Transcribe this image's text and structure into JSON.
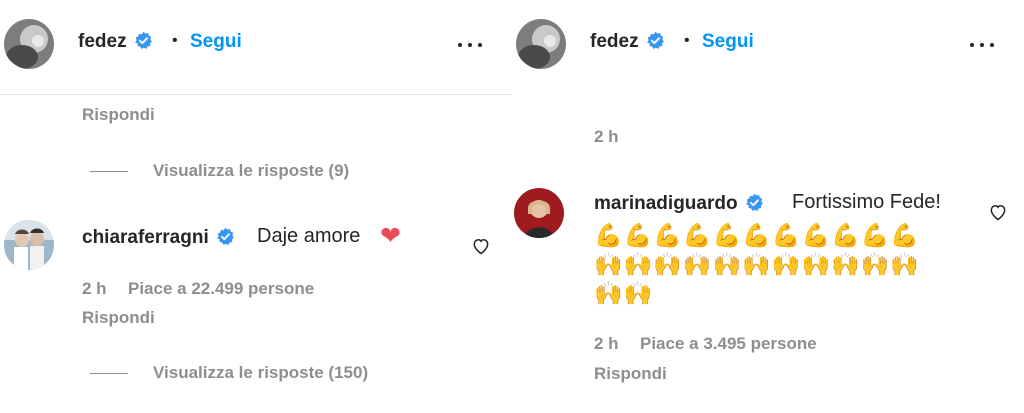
{
  "left": {
    "header": {
      "username": "fedez",
      "separator": "•",
      "follow_label": "Segui"
    },
    "top": {
      "reply_label": "Rispondi",
      "view_replies": "Visualizza le risposte (9)"
    },
    "comment": {
      "username": "chiaraferragni",
      "text": "Daje amore",
      "emoji": "❤",
      "time": "2 h",
      "likes": "Piace a 22.499 persone",
      "reply_label": "Rispondi",
      "view_replies": "Visualizza le risposte (150)"
    }
  },
  "right": {
    "header": {
      "username": "fedez",
      "separator": "•",
      "follow_label": "Segui"
    },
    "top": {
      "time": "2 h"
    },
    "comment": {
      "username": "marinadiguardo",
      "text": "Fortissimo Fede!",
      "emoji_rows": [
        "💪💪💪💪💪💪💪💪💪💪💪",
        "🙌🙌🙌🙌🙌🙌🙌🙌🙌🙌🙌",
        "🙌🙌"
      ],
      "time": "2 h",
      "likes": "Piace a 3.495 persone",
      "reply_label": "Rispondi"
    }
  },
  "colors": {
    "verified": "#3897f0",
    "link": "#0095f6",
    "meta": "#8e8e8e",
    "heart": "#ed4956"
  }
}
